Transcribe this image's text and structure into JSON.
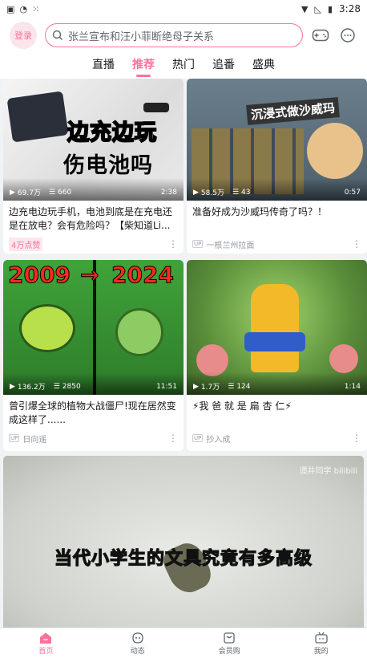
{
  "status_bar": {
    "time": "3:28"
  },
  "header": {
    "login_label": "登录",
    "search_placeholder": "张兰宣布和汪小菲断绝母子关系",
    "icons": [
      "game-controller-icon",
      "message-icon"
    ]
  },
  "tabs": [
    {
      "label": "直播",
      "active": false
    },
    {
      "label": "推荐",
      "active": true
    },
    {
      "label": "热门",
      "active": false
    },
    {
      "label": "追番",
      "active": false
    },
    {
      "label": "盛典",
      "active": false
    }
  ],
  "cards": [
    {
      "thumb_text": [
        "边充边玩",
        "伤电池吗"
      ],
      "views": "69.7万",
      "danmaku": "660",
      "duration": "2:38",
      "title": "边充电边玩手机，电池到底是在充电还是在放电？会有危险吗？【柴知道Li...",
      "badge": "4万点赞",
      "author": ""
    },
    {
      "thumb_text": [
        "沉浸式做沙威玛"
      ],
      "views": "58.5万",
      "danmaku": "43",
      "duration": "0:57",
      "title": "准备好成为沙威玛传奇了吗？！",
      "badge": "",
      "author": "一根兰州拉面"
    },
    {
      "thumb_text": [
        "2009",
        "→",
        "2024"
      ],
      "views": "136.2万",
      "danmaku": "2850",
      "duration": "11:51",
      "title": "曾引爆全球的植物大战僵尸!现在居然变成这样了......",
      "badge": "",
      "author": "日向遥"
    },
    {
      "thumb_text": [],
      "views": "1.7万",
      "danmaku": "124",
      "duration": "1:14",
      "title": "⚡我 爸 就 是 扁 杏 仁⚡",
      "badge": "",
      "author": "抄入成"
    }
  ],
  "big_card": {
    "watermark": "谭井同学 bilibili",
    "caption": "当代小学生的文具究竟有多高级"
  },
  "bottom_nav": [
    {
      "label": "首页",
      "icon": "home-icon",
      "active": true
    },
    {
      "label": "动态",
      "icon": "dynamic-icon",
      "active": false
    },
    {
      "label": "会员购",
      "icon": "shop-icon",
      "active": false
    },
    {
      "label": "我的",
      "icon": "tv-icon",
      "active": false
    }
  ],
  "colors": {
    "accent": "#fb7299"
  }
}
